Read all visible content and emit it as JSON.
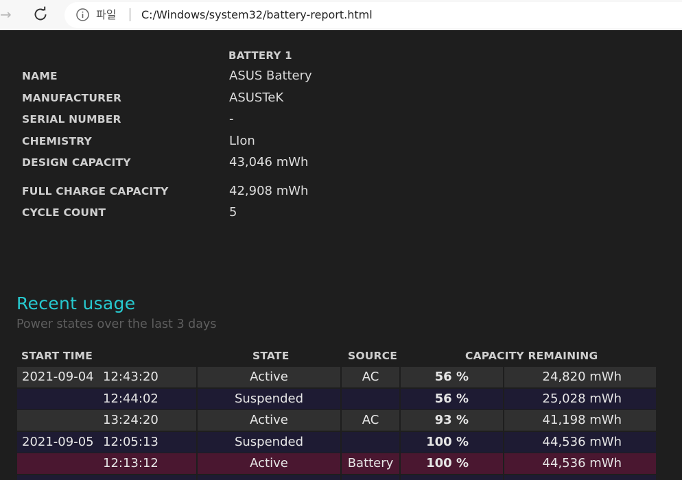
{
  "browser": {
    "scheme_label": "파일",
    "url": "C:/Windows/system32/battery-report.html"
  },
  "battery_info": {
    "column_header": "BATTERY 1",
    "rows": [
      {
        "label": "NAME",
        "value": "ASUS Battery"
      },
      {
        "label": "MANUFACTURER",
        "value": "ASUSTeK"
      },
      {
        "label": "SERIAL NUMBER",
        "value": "-"
      },
      {
        "label": "CHEMISTRY",
        "value": "LIon"
      },
      {
        "label": "DESIGN CAPACITY",
        "value": "43,046 mWh"
      },
      {
        "label": "FULL CHARGE CAPACITY",
        "value": "42,908 mWh"
      },
      {
        "label": "CYCLE COUNT",
        "value": "5"
      }
    ]
  },
  "recent_usage": {
    "title": "Recent usage",
    "subtitle": "Power states over the last 3 days",
    "headers": {
      "start_time": "START TIME",
      "state": "STATE",
      "source": "SOURCE",
      "capacity": "CAPACITY REMAINING"
    },
    "rows": [
      {
        "date": "2021-09-04",
        "time": "12:43:20",
        "state": "Active",
        "source": "AC",
        "percent": "56 %",
        "mwh": "24,820 mWh"
      },
      {
        "date": "",
        "time": "12:44:02",
        "state": "Suspended",
        "source": "",
        "percent": "56 %",
        "mwh": "25,028 mWh"
      },
      {
        "date": "",
        "time": "13:24:20",
        "state": "Active",
        "source": "AC",
        "percent": "93 %",
        "mwh": "41,198 mWh"
      },
      {
        "date": "2021-09-05",
        "time": "12:05:13",
        "state": "Suspended",
        "source": "",
        "percent": "100 %",
        "mwh": "44,536 mWh"
      },
      {
        "date": "",
        "time": "12:13:12",
        "state": "Active",
        "source": "Battery",
        "percent": "100 %",
        "mwh": "44,536 mWh"
      }
    ]
  },
  "colors": {
    "page_bg": "#1e1e1e",
    "accent_title": "#27c9cf",
    "row_ac": "#303030",
    "row_suspended": "#1e1b33",
    "row_battery": "#4a1730"
  }
}
